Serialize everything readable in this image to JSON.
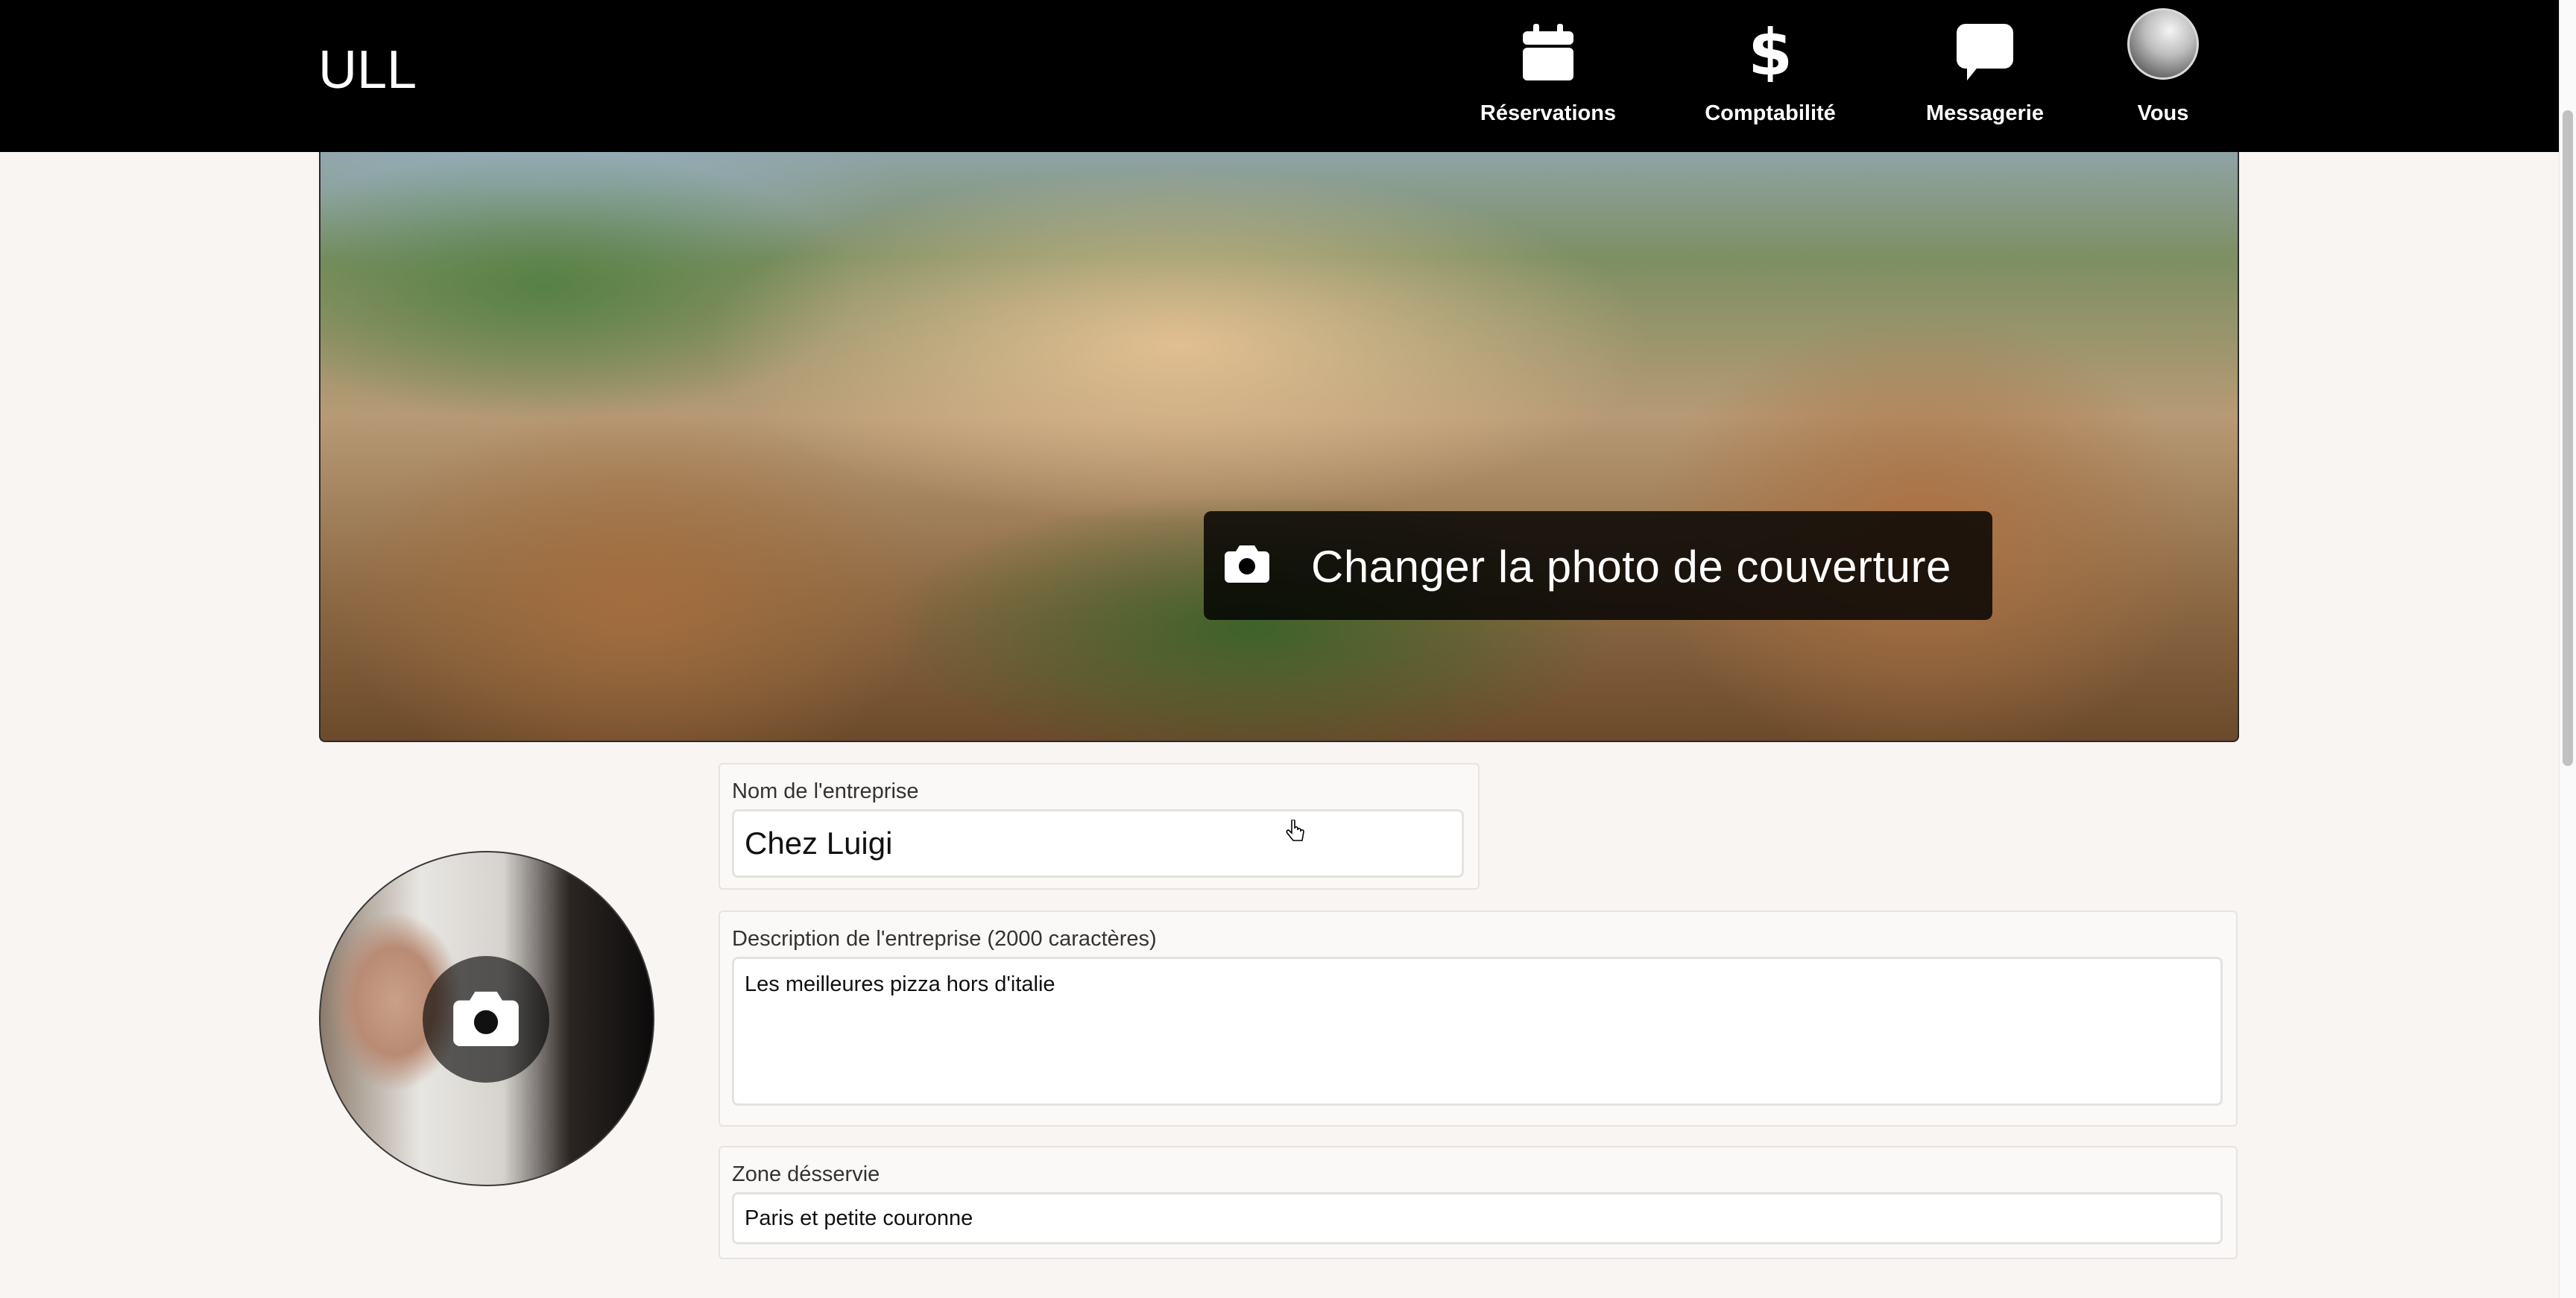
{
  "navbar": {
    "brand": "ULL",
    "items": [
      {
        "label": "Réservations",
        "icon": "calendar-icon"
      },
      {
        "label": "Comptabilité",
        "icon": "dollar-icon"
      },
      {
        "label": "Messagerie",
        "icon": "chat-bubble-icon"
      },
      {
        "label": "Vous",
        "icon": "user-avatar"
      }
    ]
  },
  "cover": {
    "button_label": "Changer la photo de couverture",
    "icon": "camera-icon"
  },
  "profile": {
    "icon": "camera-icon"
  },
  "form": {
    "company_name": {
      "label": "Nom de l'entreprise",
      "value": "Chez Luigi"
    },
    "description": {
      "label": "Description de l'entreprise (2000 caractères)",
      "value": "Les meilleures pizza hors d'italie"
    },
    "zone": {
      "label": "Zone désservie",
      "value": "Paris et petite couronne"
    }
  },
  "colors": {
    "navbar": "#000000",
    "page_background": "#f8f5f3",
    "overlay": "#000000"
  }
}
